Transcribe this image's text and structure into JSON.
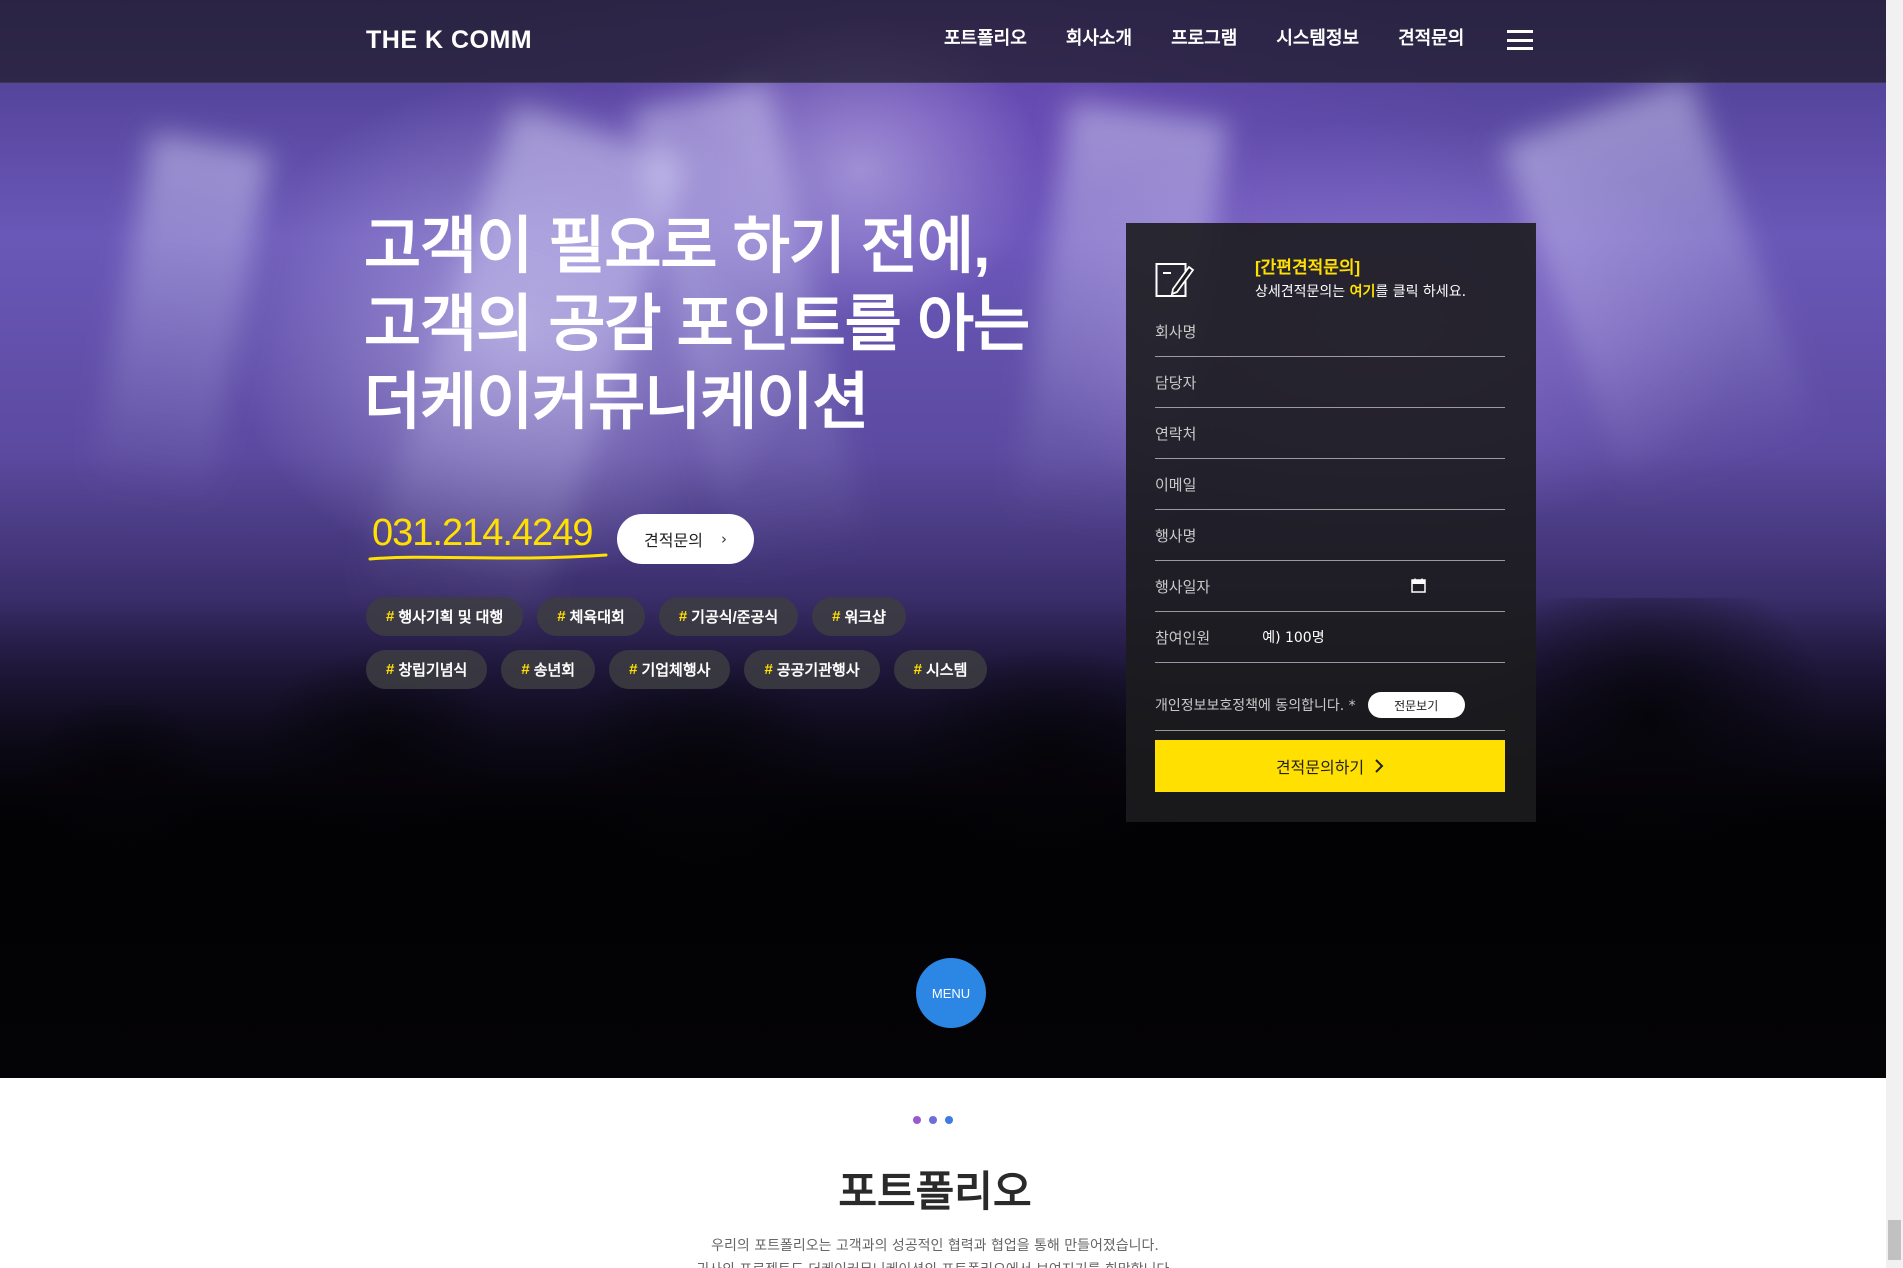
{
  "header": {
    "logo": "THE K COMM",
    "nav": [
      "포트폴리오",
      "회사소개",
      "프로그램",
      "시스템정보",
      "견적문의"
    ]
  },
  "hero": {
    "headline": [
      "고객이 필요로 하기 전에,",
      "고객의 공감 포인트를 아는",
      "더케이커뮤니케이션"
    ],
    "phone": "031.214.4249",
    "quote_button": "견적문의",
    "tags_row1": [
      "행사기획 및 대행",
      "체육대회",
      "기공식/준공식",
      "워크샵"
    ],
    "tags_row2": [
      "창립기념식",
      "송년회",
      "기업체행사",
      "공공기관행사",
      "시스템"
    ]
  },
  "form": {
    "title": "[간편견적문의]",
    "sub_before": "상세견적문의는 ",
    "sub_highlight": "여기",
    "sub_after": "를 클릭 하세요.",
    "company_placeholder": "회사명",
    "manager_placeholder": "담당자",
    "contact_placeholder": "연락처",
    "email_placeholder": "이메일",
    "event_placeholder": "행사명",
    "date_placeholder": "행사일자",
    "attendees_label": "참여인원",
    "attendees_example": "예) 100명",
    "privacy_text": "개인정보보호정책에 동의합니다. *",
    "privacy_view": "전문보기",
    "submit_label": "견적문의하기"
  },
  "menu_button": "MENU",
  "portfolio": {
    "title": "포트폴리오",
    "desc_line1": "우리의 포트폴리오는 고객과의 성공적인 협력과 협업을 통해 만들어졌습니다.",
    "desc_line2": "귀사의 프로젝트도 더케이커뮤니케이션의 포트폴리오에서 보여지기를 희망합니다."
  },
  "colors": {
    "accent_yellow": "#ffe000",
    "menu_blue": "#2b86e4",
    "dot_colors": [
      "#9b59d0",
      "#6b6fd8",
      "#3f7be0"
    ]
  },
  "icons": {
    "hamburger": "hamburger-menu-icon",
    "form": "pen-note-icon",
    "calendar": "calendar-icon",
    "chevron": "chevron-right-icon"
  }
}
